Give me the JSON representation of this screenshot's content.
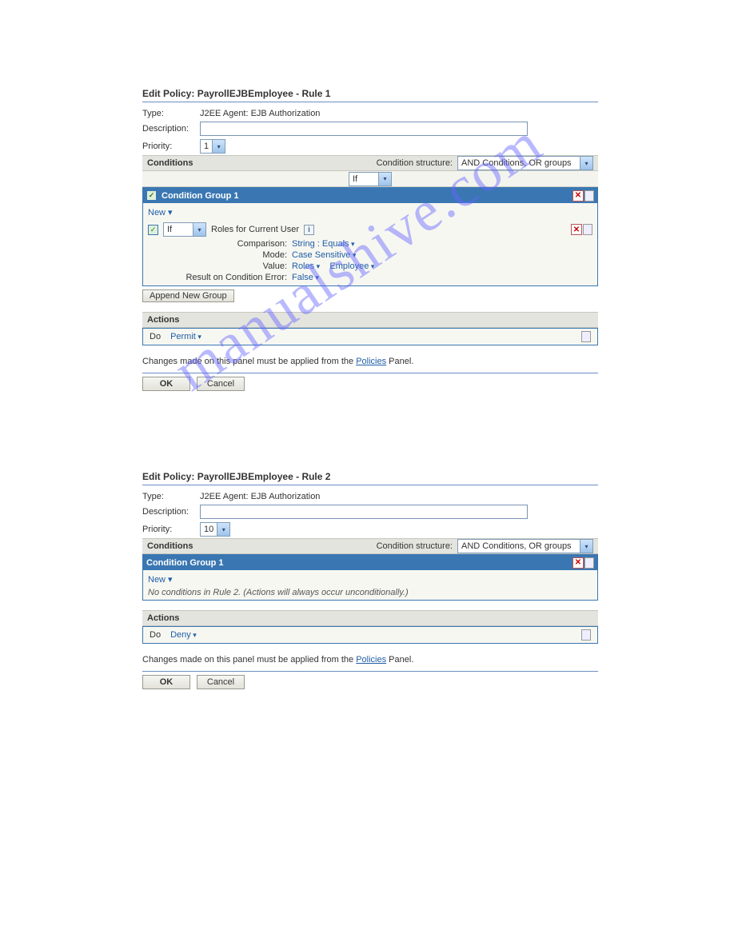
{
  "watermark": "manualshive.com",
  "rule1": {
    "title_prefix": "Edit Policy",
    "policy_name": "PayrollEJBEmployee",
    "rule_suffix": "Rule 1",
    "type_label": "Type:",
    "type_value": "J2EE Agent: EJB Authorization",
    "description_label": "Description:",
    "description_value": "",
    "priority_label": "Priority:",
    "priority_value": "1",
    "conditions_label": "Conditions",
    "cond_structure_label": "Condition structure:",
    "cond_structure_value": "AND Conditions, OR groups",
    "if_selector": "If",
    "group_title": "Condition Group 1",
    "new_label": "New ▾",
    "cond_if": "If",
    "cond_text": "Roles for Current User",
    "kv": [
      {
        "k": "Comparison:",
        "v": "String : Equals"
      },
      {
        "k": "Mode:",
        "v": "Case Sensitive"
      },
      {
        "k": "Value:",
        "v": "Roles",
        "v2": "Employee"
      },
      {
        "k": "Result on Condition Error:",
        "v": "False"
      }
    ],
    "append_group": "Append New Group",
    "actions_label": "Actions",
    "do_label": "Do",
    "action_value": "Permit",
    "footer_note_a": "Changes made on this panel must be applied from the ",
    "footer_note_link": "Policies",
    "footer_note_b": " Panel.",
    "ok": "OK",
    "cancel": "Cancel"
  },
  "rule2": {
    "title_prefix": "Edit Policy",
    "policy_name": "PayrollEJBEmployee",
    "rule_suffix": "Rule 2",
    "type_label": "Type:",
    "type_value": "J2EE Agent: EJB Authorization",
    "description_label": "Description:",
    "description_value": "",
    "priority_label": "Priority:",
    "priority_value": "10",
    "conditions_label": "Conditions",
    "cond_structure_label": "Condition structure:",
    "cond_structure_value": "AND Conditions, OR groups",
    "group_title": "Condition Group 1",
    "new_label": "New ▾",
    "no_conditions": "No conditions in Rule 2. (Actions will always occur unconditionally.)",
    "actions_label": "Actions",
    "do_label": "Do",
    "action_value": "Deny",
    "footer_note_a": "Changes made on this panel must be applied from the ",
    "footer_note_link": "Policies",
    "footer_note_b": " Panel.",
    "ok": "OK",
    "cancel": "Cancel"
  }
}
